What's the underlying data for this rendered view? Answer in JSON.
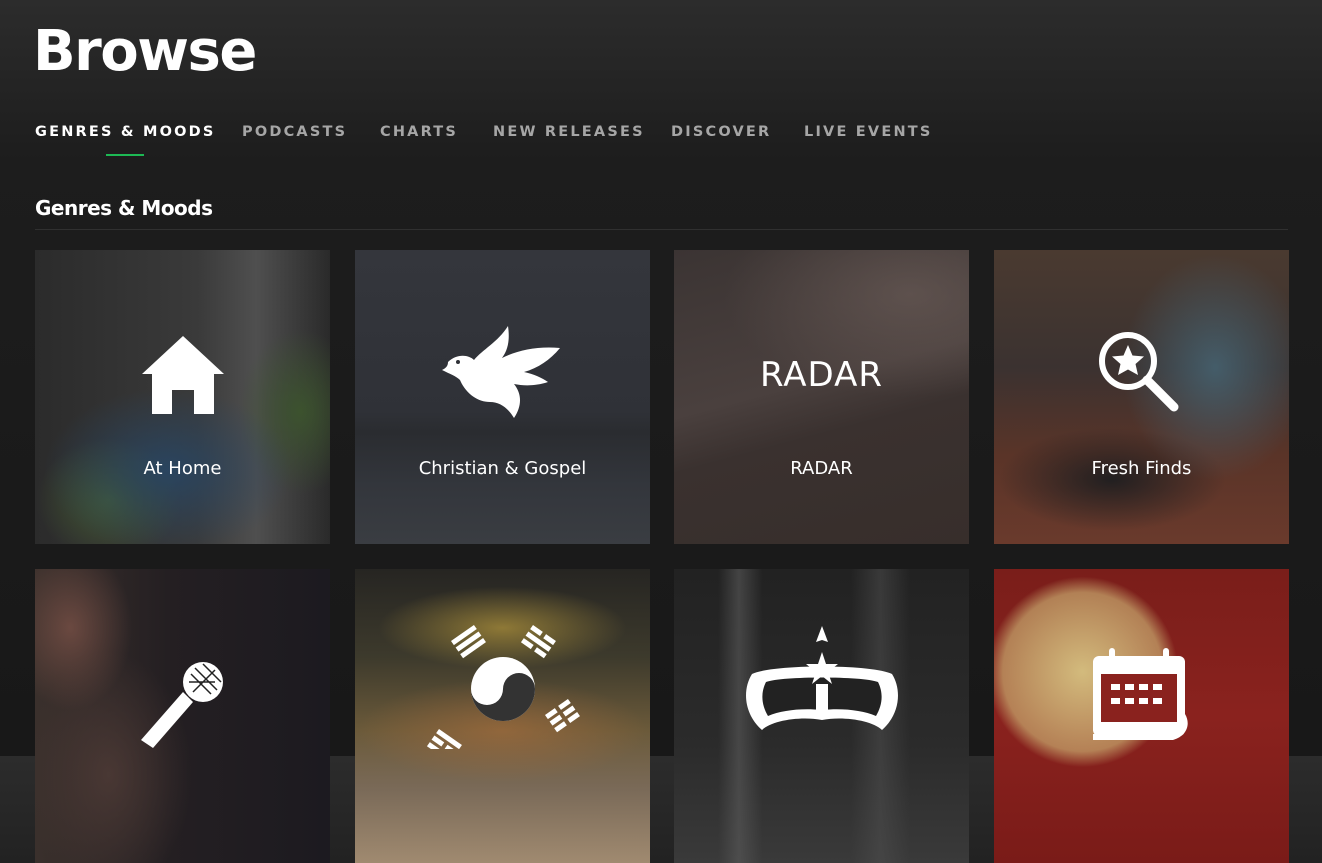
{
  "page": {
    "title": "Browse"
  },
  "tabs": [
    {
      "label": "GENRES & MOODS",
      "active": true
    },
    {
      "label": "PODCASTS",
      "active": false
    },
    {
      "label": "CHARTS",
      "active": false
    },
    {
      "label": "NEW RELEASES",
      "active": false
    },
    {
      "label": "DISCOVER",
      "active": false
    },
    {
      "label": "LIVE EVENTS",
      "active": false
    }
  ],
  "accent_color": "#1db954",
  "section": {
    "title": "Genres & Moods"
  },
  "cards": [
    {
      "label": "At Home",
      "icon": "house-icon"
    },
    {
      "label": "Christian & Gospel",
      "icon": "dove-icon"
    },
    {
      "label": "RADAR",
      "icon": "radar-wordmark",
      "wordmark": "RADAR"
    },
    {
      "label": "Fresh Finds",
      "icon": "magnifier-star-icon"
    },
    {
      "label": "",
      "icon": "microphone-icon"
    },
    {
      "label": "",
      "icon": "korean-flag-icon"
    },
    {
      "label": "",
      "icon": "malaysian-crest-icon"
    },
    {
      "label": "",
      "icon": "calendar-icon"
    }
  ]
}
